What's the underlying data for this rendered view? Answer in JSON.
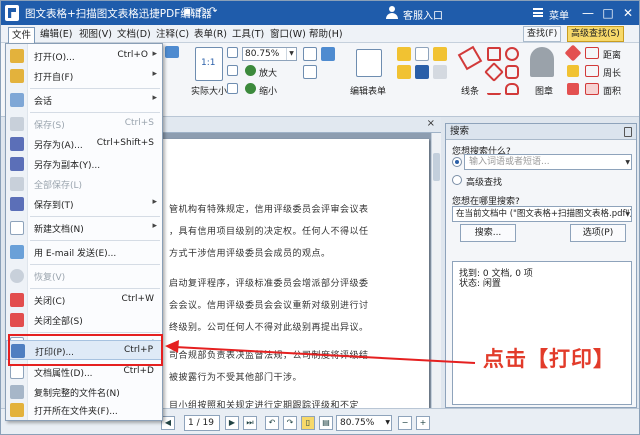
{
  "window": {
    "title": "图文表格+扫描图文表格迅捷PDF编辑器",
    "login_label": "客服入口",
    "menu_label": "菜单",
    "minimize": "—",
    "maximize": "□",
    "close": "✕"
  },
  "menubar": {
    "items": [
      "文件",
      "编辑(E)",
      "视图(V)",
      "文档(D)",
      "注释(C)",
      "表单(R)",
      "工具(T)",
      "窗口(W)",
      "帮助(H)"
    ],
    "find_label": "查找(F)",
    "advanced_find_label": "高级查找(S)"
  },
  "ribbon": {
    "zoom_value": "80.75%",
    "zoom_in": "放大",
    "zoom_out": "缩小",
    "actual_size": "实际大小",
    "edit_form": "编辑表单",
    "lines": "线条",
    "stamp": "图章",
    "distance": "距离",
    "perimeter": "周长",
    "area": "面积",
    "fit_label": "1:1"
  },
  "file_menu": {
    "items": [
      {
        "label": "打开(O)...",
        "shortcut": "Ctrl+O",
        "submenu": true,
        "disabled": false
      },
      {
        "label": "打开自(F)",
        "shortcut": "",
        "submenu": true,
        "disabled": false
      },
      {
        "label": "会话",
        "shortcut": "",
        "submenu": true,
        "disabled": false
      },
      {
        "label": "保存(S)",
        "shortcut": "Ctrl+S",
        "submenu": false,
        "disabled": true
      },
      {
        "label": "另存为(A)...",
        "shortcut": "Ctrl+Shift+S",
        "submenu": false,
        "disabled": false
      },
      {
        "label": "另存为副本(Y)...",
        "shortcut": "",
        "submenu": false,
        "disabled": false
      },
      {
        "label": "全部保存(L)",
        "shortcut": "",
        "submenu": false,
        "disabled": true
      },
      {
        "label": "保存到(T)",
        "shortcut": "",
        "submenu": true,
        "disabled": false
      },
      {
        "label": "新建文档(N)",
        "shortcut": "",
        "submenu": true,
        "disabled": false
      },
      {
        "label": "用 E-mail 发送(E)...",
        "shortcut": "",
        "submenu": false,
        "disabled": false
      },
      {
        "label": "恢复(V)",
        "shortcut": "",
        "submenu": false,
        "disabled": true
      },
      {
        "label": "关闭(C)",
        "shortcut": "Ctrl+W",
        "submenu": false,
        "disabled": false
      },
      {
        "label": "关闭全部(S)",
        "shortcut": "",
        "submenu": false,
        "disabled": false
      },
      {
        "label": "导出",
        "shortcut": "",
        "submenu": true,
        "disabled": false
      },
      {
        "label": "打印(P)...",
        "shortcut": "Ctrl+P",
        "submenu": false,
        "disabled": false
      },
      {
        "label": "文档属性(D)...",
        "shortcut": "Ctrl+D",
        "submenu": false,
        "disabled": false
      },
      {
        "label": "复制完整的文件名(N)",
        "shortcut": "",
        "submenu": false,
        "disabled": false
      },
      {
        "label": "打开所在文件夹(F)...",
        "shortcut": "",
        "submenu": false,
        "disabled": false
      }
    ],
    "submenu_arrow": "▸"
  },
  "document": {
    "lines": [
      "管机构有特殊规定，信用评级委员会评审会议表",
      "，具有信用项目级别的决定权。任何人不得以任",
      "方式干涉信用评级委员会成员的观点。",
      "启动复评程序，评级标准委员会增派部分评级委",
      "会会议。信用评级委员会会议重新对级别进行讨",
      "终级别。公司任何人不得对此级别再提出异议。",
      "司合规部负责表决监督法规，公司制度将评级结",
      "被披露行为不受其他部门干涉。",
      "目小组按照和关规定进行定期跟踪评级和不定"
    ]
  },
  "statusbar": {
    "page_value": "1 / 19",
    "zoom_value": "80.75%"
  },
  "search_panel": {
    "title": "搜索",
    "question": "您想搜索什么?",
    "input_placeholder": "输入词语或者短语...",
    "advanced_option": "高级查找",
    "where_question": "您想在哪里搜索?",
    "where_value": "在当前文档中 (\"图文表格+扫描图文表格.pdf\")",
    "search_button": "搜索...",
    "options_button": "选项(P)",
    "found_label": "找到: 0 文档, 0 项",
    "status_label": "状态: 闲置"
  },
  "annotation": {
    "callout": "点击【打印】"
  }
}
